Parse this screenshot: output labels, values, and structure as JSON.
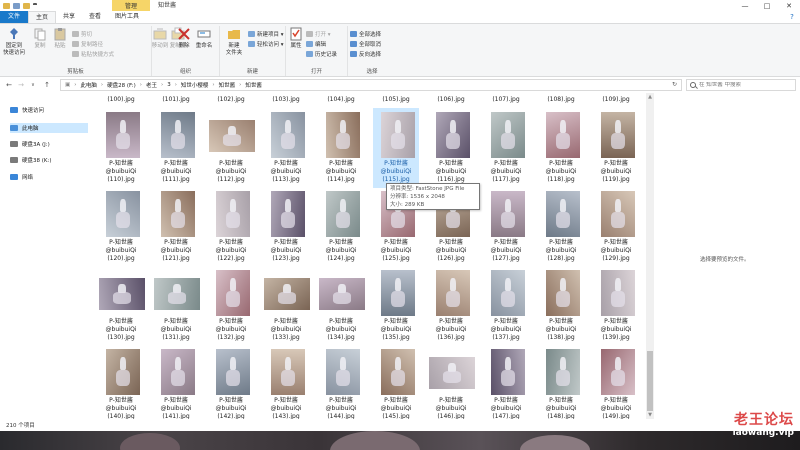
{
  "window": {
    "title": "知世酱",
    "context_tab": "管理",
    "minimize": "—",
    "maximize": "□",
    "close": "✕"
  },
  "tabs": [
    {
      "label": "文件"
    },
    {
      "label": "主页"
    },
    {
      "label": "共享"
    },
    {
      "label": "查看"
    },
    {
      "label": "图片工具"
    }
  ],
  "ribbon": {
    "clipboard": {
      "label": "剪贴板",
      "pin": "固定到\n快速访问",
      "copy": "复制",
      "paste": "粘贴",
      "cut": "剪切",
      "copy_path": "复制路径",
      "paste_shortcut": "粘贴快捷方式"
    },
    "organize": {
      "label": "组织",
      "move_to": "移动到",
      "copy_to": "复制到",
      "delete": "删除",
      "rename": "重命名"
    },
    "new": {
      "label": "新建",
      "new_folder": "新建\n文件夹",
      "new_item": "新建项目 ▾",
      "easy_access": "轻松访问 ▾"
    },
    "open": {
      "label": "打开",
      "properties": "属性",
      "open": "打开 ▾",
      "edit": "编辑",
      "history": "历史记录"
    },
    "select": {
      "label": "选择",
      "select_all": "全部选择",
      "select_none": "全部取消",
      "invert": "反向选择"
    }
  },
  "address": {
    "back": "←",
    "forward": "→",
    "up": "↑",
    "dropdown": "∨",
    "crumbs": [
      "此电脑",
      "硬盘28 (F:)",
      "老王",
      "3",
      "知世小樱樱",
      "知世酱",
      "知世酱"
    ],
    "refresh": "↻",
    "search_placeholder": "在 知世酱 中搜索"
  },
  "navpane": [
    {
      "label": "快速访问",
      "color": "#3a86d8"
    },
    {
      "label": "此电脑",
      "color": "#4a90d9"
    },
    {
      "label": "硬盘3A (J:)",
      "color": "#7a7a7a"
    },
    {
      "label": "硬盘38 (K:)",
      "color": "#7a7a7a"
    },
    {
      "label": "网络",
      "color": "#3a86d8"
    }
  ],
  "files": {
    "prefix": "P-知世酱",
    "author": "@buibuiQi",
    "top_row": [
      "(100).jpg",
      "(101).jpg",
      "(102).jpg",
      "(103).jpg",
      "(104).jpg",
      "(105).jpg",
      "(106).jpg",
      "(107).jpg",
      "(108).jpg",
      "(109).jpg"
    ],
    "rows": [
      [
        "(110).jpg",
        "(111).jpg",
        "(112).jpg",
        "(113).jpg",
        "(114).jpg",
        "(115).jpg",
        "(116).jpg",
        "(117).jpg",
        "(118).jpg",
        "(119).jpg"
      ],
      [
        "(120).jpg",
        "(121).jpg",
        "(122).jpg",
        "(123).jpg",
        "(124).jpg",
        "(125).jpg",
        "(126).jpg",
        "(127).jpg",
        "(128).jpg",
        "(129).jpg"
      ],
      [
        "(130).jpg",
        "(131).jpg",
        "(132).jpg",
        "(133).jpg",
        "(134).jpg",
        "(135).jpg",
        "(136).jpg",
        "(137).jpg",
        "(138).jpg",
        "(139).jpg"
      ],
      [
        "(140).jpg",
        "(141).jpg",
        "(142).jpg",
        "(143).jpg",
        "(144).jpg",
        "(145).jpg",
        "(146).jpg",
        "(147).jpg",
        "(148).jpg",
        "(149).jpg"
      ]
    ],
    "selected": "(115).jpg"
  },
  "tooltip": {
    "type": "项目类型: FastStone JPG File",
    "resolution": "分辨率: 1536 x 2048",
    "size": "大小: 289 KB"
  },
  "preview": {
    "message": "选择要预览的文件。"
  },
  "status": {
    "count": "210 个项目"
  },
  "watermark": {
    "text": "老王论坛",
    "url": "laowang.vip"
  },
  "colors": {
    "file_tab": "#1979ca",
    "context_tab": "#f6d568",
    "selection": "#cce8ff",
    "watermark": "#d72a2a"
  }
}
